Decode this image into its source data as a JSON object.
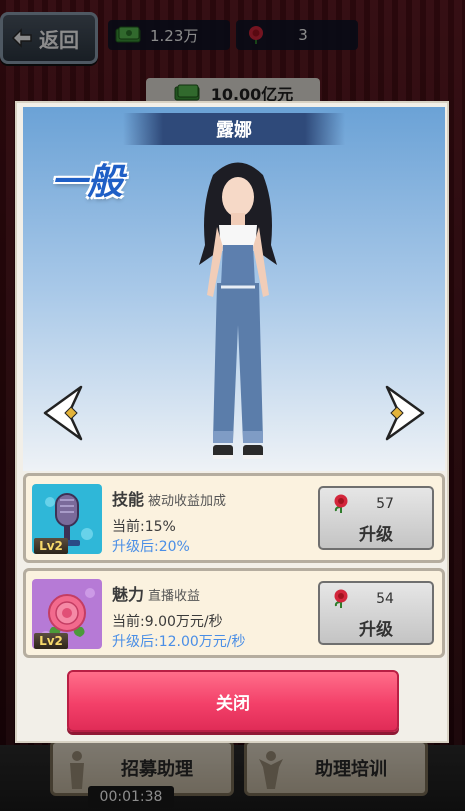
{
  "header": {
    "back_label": "返回",
    "money_value": "1.23万",
    "rose_value": "3",
    "total_value": "10.00亿元"
  },
  "bottom": {
    "recruit_label": "招募助理",
    "train_label": "助理培训",
    "timer": "00:01:38"
  },
  "modal": {
    "character_name": "露娜",
    "rarity": "一般",
    "skills": [
      {
        "name": "技能",
        "description": "被动收益加成",
        "level": "Lv2",
        "current": "当前:15%",
        "next": "升级后:20%",
        "cost": "57",
        "upgrade_label": "升级"
      },
      {
        "name": "魅力",
        "description": "直播收益",
        "level": "Lv2",
        "current": "当前:9.00万元/秒",
        "next": "升级后:12.00万元/秒",
        "cost": "54",
        "upgrade_label": "升级"
      }
    ],
    "close_label": "关闭"
  },
  "colors": {
    "accent_pink": "#f34069",
    "rarity_blue": "#1f5fc6",
    "next_blue": "#4a8ee6"
  },
  "icons": [
    "back-arrow-icon",
    "money-icon",
    "rose-icon",
    "left-arrow-icon",
    "right-arrow-icon",
    "microphone-icon"
  ]
}
